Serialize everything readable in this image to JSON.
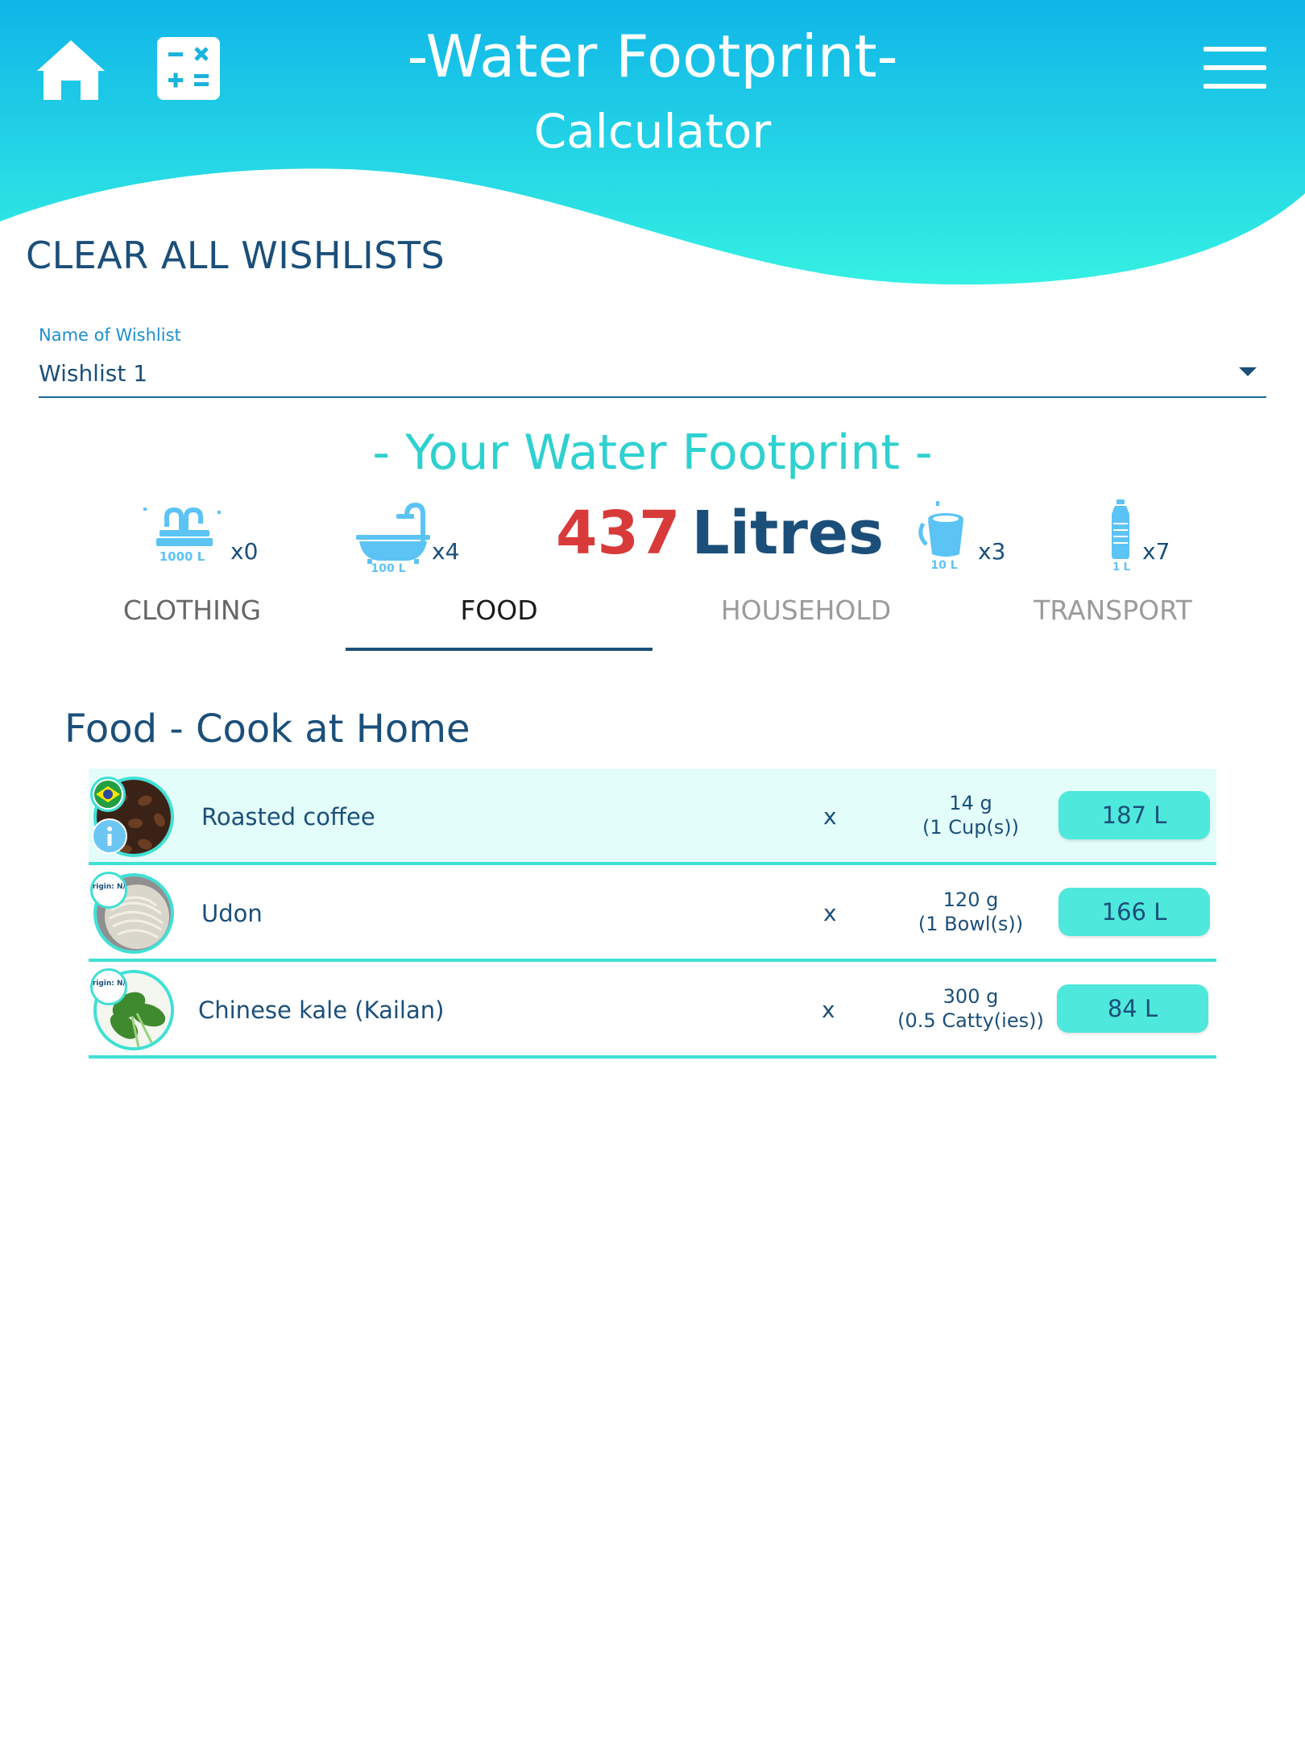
{
  "header": {
    "title": "-Water Footprint-",
    "subtitle": "Calculator",
    "icons": [
      "home-icon",
      "calculator-icon",
      "menu-icon"
    ],
    "gradient": [
      "#10b5e8",
      "#35f0e3"
    ]
  },
  "clear_all_label": "CLEAR ALL WISHLISTS",
  "wishlist_select": {
    "label": "Name of Wishlist",
    "value": "Wishlist 1"
  },
  "footprint": {
    "heading": "- Your Water Footprint -",
    "total_value": "437",
    "total_unit": "Litres",
    "equivalents": [
      {
        "icon": "fountain-icon",
        "volume": "1000 L",
        "count": "x0"
      },
      {
        "icon": "bathtub-icon",
        "volume": "100 L",
        "count": "x4"
      },
      {
        "icon": "bucket-icon",
        "volume": "10 L",
        "count": "x3"
      },
      {
        "icon": "bottle-icon",
        "volume": "1 L",
        "count": "x7"
      }
    ]
  },
  "tabs": [
    {
      "label": "CLOTHING"
    },
    {
      "label": "FOOD"
    },
    {
      "label": "HOUSEHOLD"
    },
    {
      "label": "TRANSPORT"
    }
  ],
  "active_tab": "FOOD",
  "section_title": "Food - Cook at Home",
  "items": [
    {
      "name": "Roasted coffee",
      "times": "x",
      "qty_line1": "14 g",
      "qty_line2": "(1 Cup(s))",
      "footprint": "187 L",
      "origin": "brazil-flag-icon"
    },
    {
      "name": "Udon",
      "times": "x",
      "qty_line1": "120 g",
      "qty_line2": "(1 Bowl(s))",
      "footprint": "166 L",
      "origin_label": "Origin: N/A"
    },
    {
      "name": "Chinese kale (Kailan)",
      "times": "x",
      "qty_line1": "300 g",
      "qty_line2": "(0.5 Catty(ies))",
      "footprint": "84 L",
      "origin_label": "Origin: N/A"
    }
  ],
  "colors": {
    "accent": "#3fe0d5",
    "primary_text": "#1b4f7a",
    "total_number": "#d83a3a",
    "heading": "#2ed1cf"
  }
}
